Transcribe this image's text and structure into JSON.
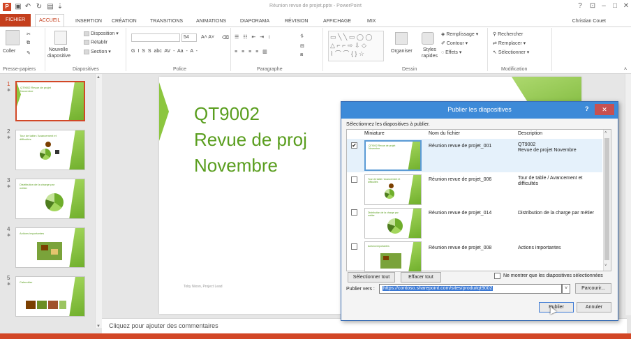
{
  "window": {
    "title": "Réunion revue de projet.pptx - PowerPoint",
    "user": "Christian Couet",
    "controls": [
      "?",
      "⊡",
      "–",
      "□",
      "✕"
    ]
  },
  "tabs": [
    "FICHIER",
    "ACCUEIL",
    "INSERTION",
    "CRÉATION",
    "TRANSITIONS",
    "ANIMATIONS",
    "DIAPORAMA",
    "RÉVISION",
    "AFFICHAGE",
    "MIX"
  ],
  "ribbon": {
    "groups": {
      "clipboard": "Presse-papiers",
      "slides": "Diapositives",
      "font": "Police",
      "paragraph": "Paragraphe",
      "drawing": "Dessin",
      "editing": "Modification"
    },
    "coller": "Coller",
    "nouvelle": "Nouvelle",
    "diapositive": "diapositive",
    "disposition": "Disposition",
    "retablir": "Rétablir",
    "section": "Section",
    "font_size": "54",
    "font_btns": "G  I  S  S  abc AV - Aa -   A -",
    "organiser": "Organiser",
    "styles": "Styles",
    "rapides": "rapides",
    "remplissage": "Remplissage",
    "contour": "Contour",
    "effets": "Effets",
    "rechercher": "Rechercher",
    "remplacer": "Remplacer",
    "selectionner": "Sélectionner"
  },
  "thumbnails": [
    {
      "num": "1",
      "title": "QT9002 Revue de projet Novembre"
    },
    {
      "num": "2",
      "title": "Tour de table / Avancement et difficultés"
    },
    {
      "num": "3",
      "title": "Distribution de la charge par métier"
    },
    {
      "num": "4",
      "title": "Actions importantes"
    },
    {
      "num": "5",
      "title": "Calendrier"
    }
  ],
  "slide": {
    "line1": "QT9002",
    "line2": "Revue de proj",
    "line3": "Novembre",
    "footer": "Toby Nixon, Project Lead"
  },
  "notes_placeholder": "Cliquez pour ajouter des commentaires",
  "dialog": {
    "title": "Publier les diapositives",
    "help": "?",
    "close": "✕",
    "instruction": "Sélectionnez les diapositives à publier.",
    "columns": {
      "thumb": "Miniature",
      "name": "Nom du fichier",
      "desc": "Description"
    },
    "rows": [
      {
        "checked": "✔",
        "name": "Réunion revue de projet_001",
        "desc": "QT9002\nRevue de projet Novembre",
        "thumb": "QT9002 Revue de projet Novembre"
      },
      {
        "checked": "",
        "name": "Réunion revue de projet_006",
        "desc": "Tour de table / Avancement et difficultés",
        "thumb": "Tour de table / Avancement et difficultés"
      },
      {
        "checked": "",
        "name": "Réunion revue de projet_014",
        "desc": "Distribution de la charge par métier",
        "thumb": "Distribution de la charge par métier"
      },
      {
        "checked": "",
        "name": "Réunion revue de projet_008",
        "desc": "Actions importantes",
        "thumb": "Actions importantes"
      }
    ],
    "select_all": "Sélectionner tout",
    "clear_all": "Effacer tout",
    "only_selected": "Ne montrer que les diapositives sélectionnées",
    "publish_to_label": "Publier vers :",
    "publish_url": "https://contoso.sharepoint.com/sites/produitqt9002",
    "browse": "Parcourir...",
    "publish": "Publier",
    "cancel": "Annuler"
  }
}
